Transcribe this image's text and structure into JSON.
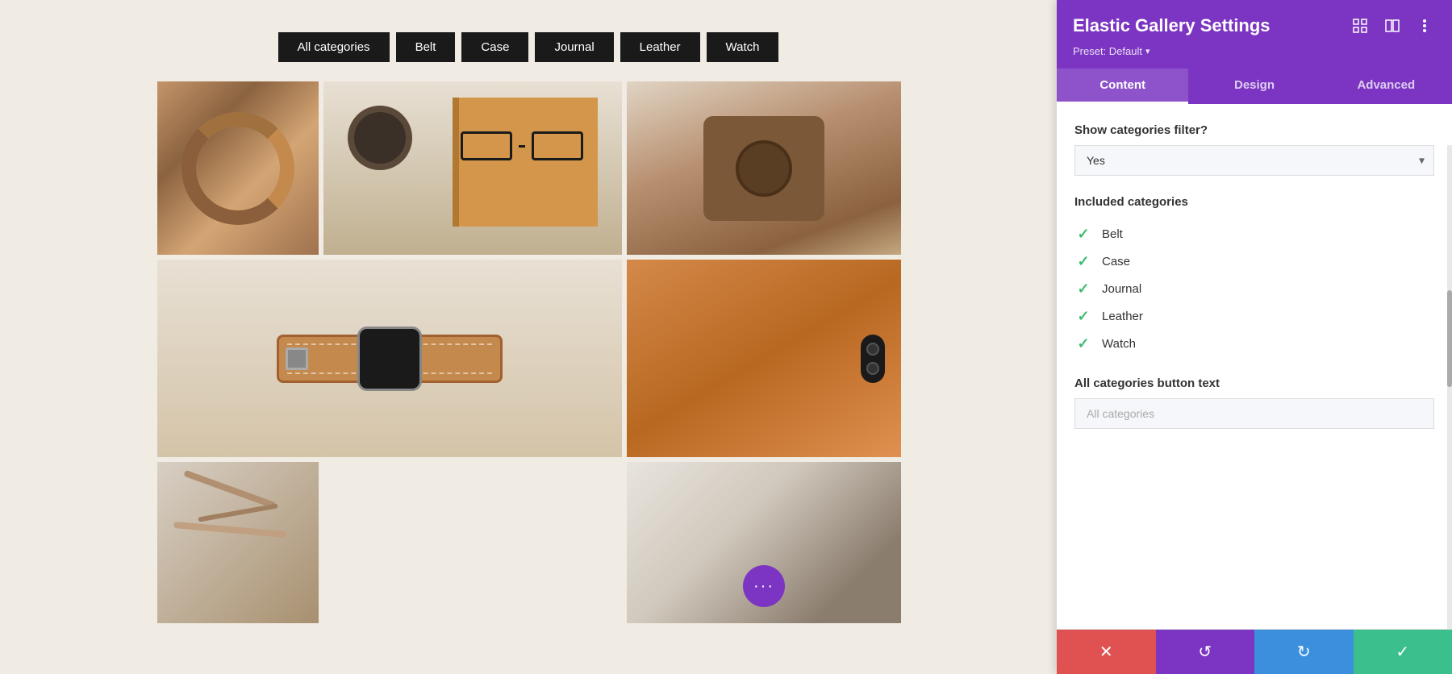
{
  "canvas": {
    "filter_buttons": [
      {
        "id": "all",
        "label": "All categories"
      },
      {
        "id": "belt",
        "label": "Belt"
      },
      {
        "id": "case",
        "label": "Case"
      },
      {
        "id": "journal",
        "label": "Journal"
      },
      {
        "id": "leather",
        "label": "Leather"
      },
      {
        "id": "watch",
        "label": "Watch"
      }
    ]
  },
  "panel": {
    "title": "Elastic Gallery Settings",
    "preset_label": "Preset: Default",
    "tabs": [
      {
        "id": "content",
        "label": "Content",
        "active": true
      },
      {
        "id": "design",
        "label": "Design",
        "active": false
      },
      {
        "id": "advanced",
        "label": "Advanced",
        "active": false
      }
    ],
    "show_categories_filter_label": "Show categories filter?",
    "show_categories_value": "Yes",
    "included_categories_label": "Included categories",
    "categories": [
      {
        "id": "belt",
        "name": "Belt",
        "checked": true
      },
      {
        "id": "case",
        "name": "Case",
        "checked": true
      },
      {
        "id": "journal",
        "name": "Journal",
        "checked": true
      },
      {
        "id": "leather",
        "name": "Leather",
        "checked": true
      },
      {
        "id": "watch",
        "name": "Watch",
        "checked": true
      }
    ],
    "all_categories_label": "All categories button text",
    "all_categories_placeholder": "All categories",
    "actions": {
      "cancel_icon": "✕",
      "undo_icon": "↺",
      "redo_icon": "↻",
      "save_icon": "✓"
    }
  },
  "colors": {
    "panel_purple": "#7b35c2",
    "check_green": "#3dbb6e",
    "cancel_red": "#e05252",
    "save_teal": "#3bbf8c",
    "redo_blue": "#3b8fdd"
  }
}
